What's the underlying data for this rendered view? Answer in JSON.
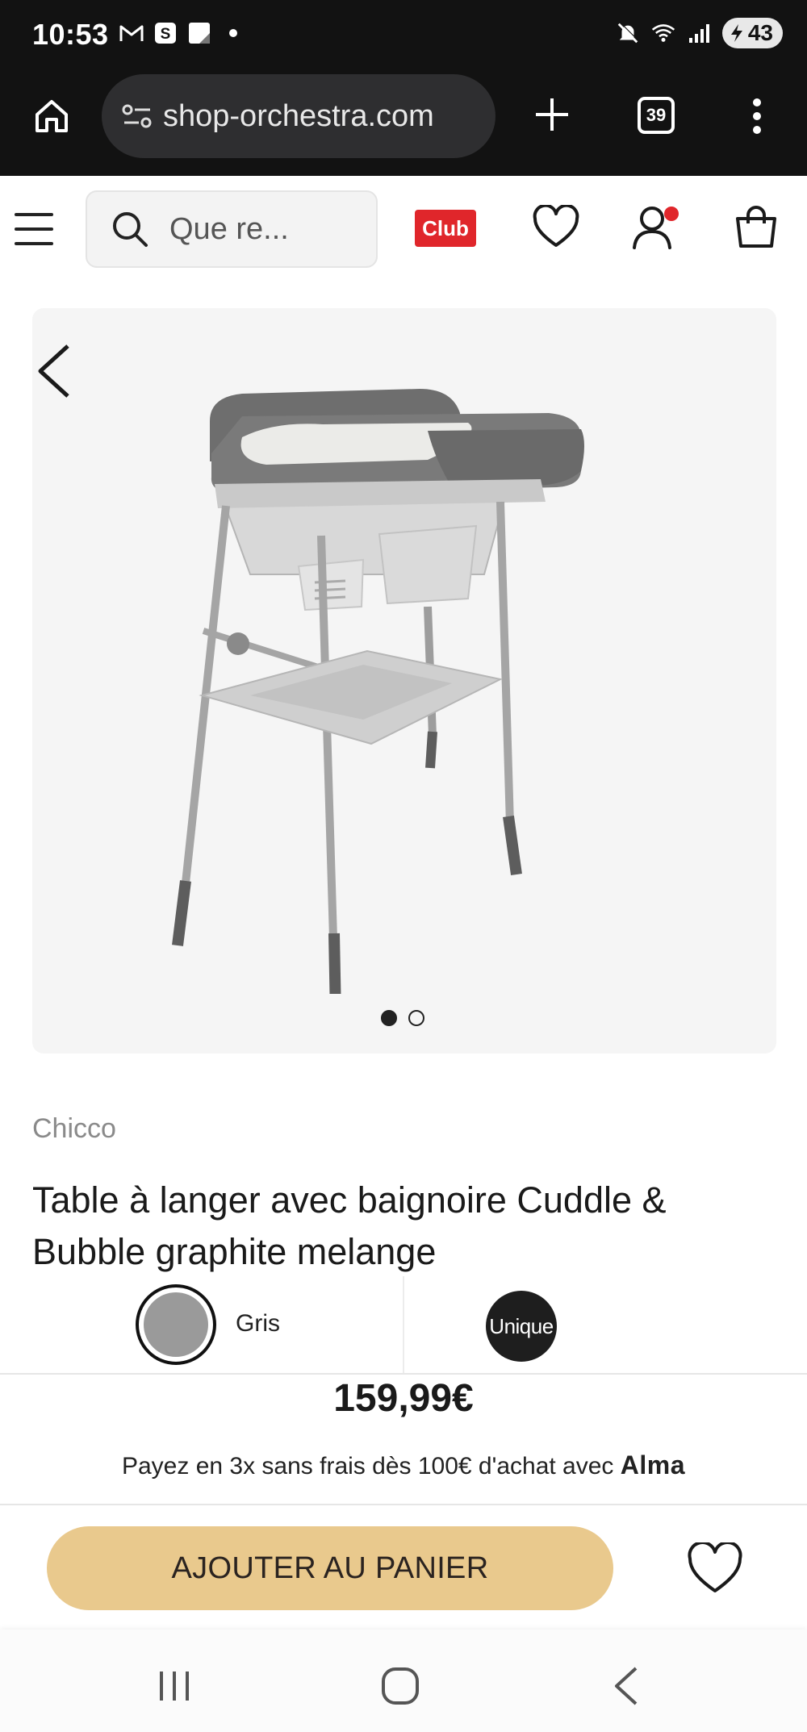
{
  "status_bar": {
    "time": "10:53",
    "battery": "43",
    "icons": [
      "gmail-icon",
      "s-app-icon",
      "notes-icon",
      "dot-icon",
      "mute-icon",
      "wifi-icon",
      "signal-icon",
      "battery-icon"
    ]
  },
  "browser": {
    "url": "shop-orchestra.com",
    "tab_count": "39"
  },
  "header": {
    "search_placeholder": "Que re...",
    "club_label": "Club",
    "accent_color": "#e0262b"
  },
  "gallery": {
    "image_count": 2,
    "active_index": 0
  },
  "product": {
    "brand": "Chicco",
    "title": "Table à langer avec baignoire Cuddle & Bubble graphite melange",
    "color_label": "Gris",
    "size_label": "Unique",
    "price": "159,99€",
    "alma_text": "Payez en 3x sans frais dès 100€ d'achat avec",
    "alma_brand": "Alma",
    "add_to_cart": "AJOUTER AU PANIER",
    "cta_color": "#e9c98d"
  }
}
